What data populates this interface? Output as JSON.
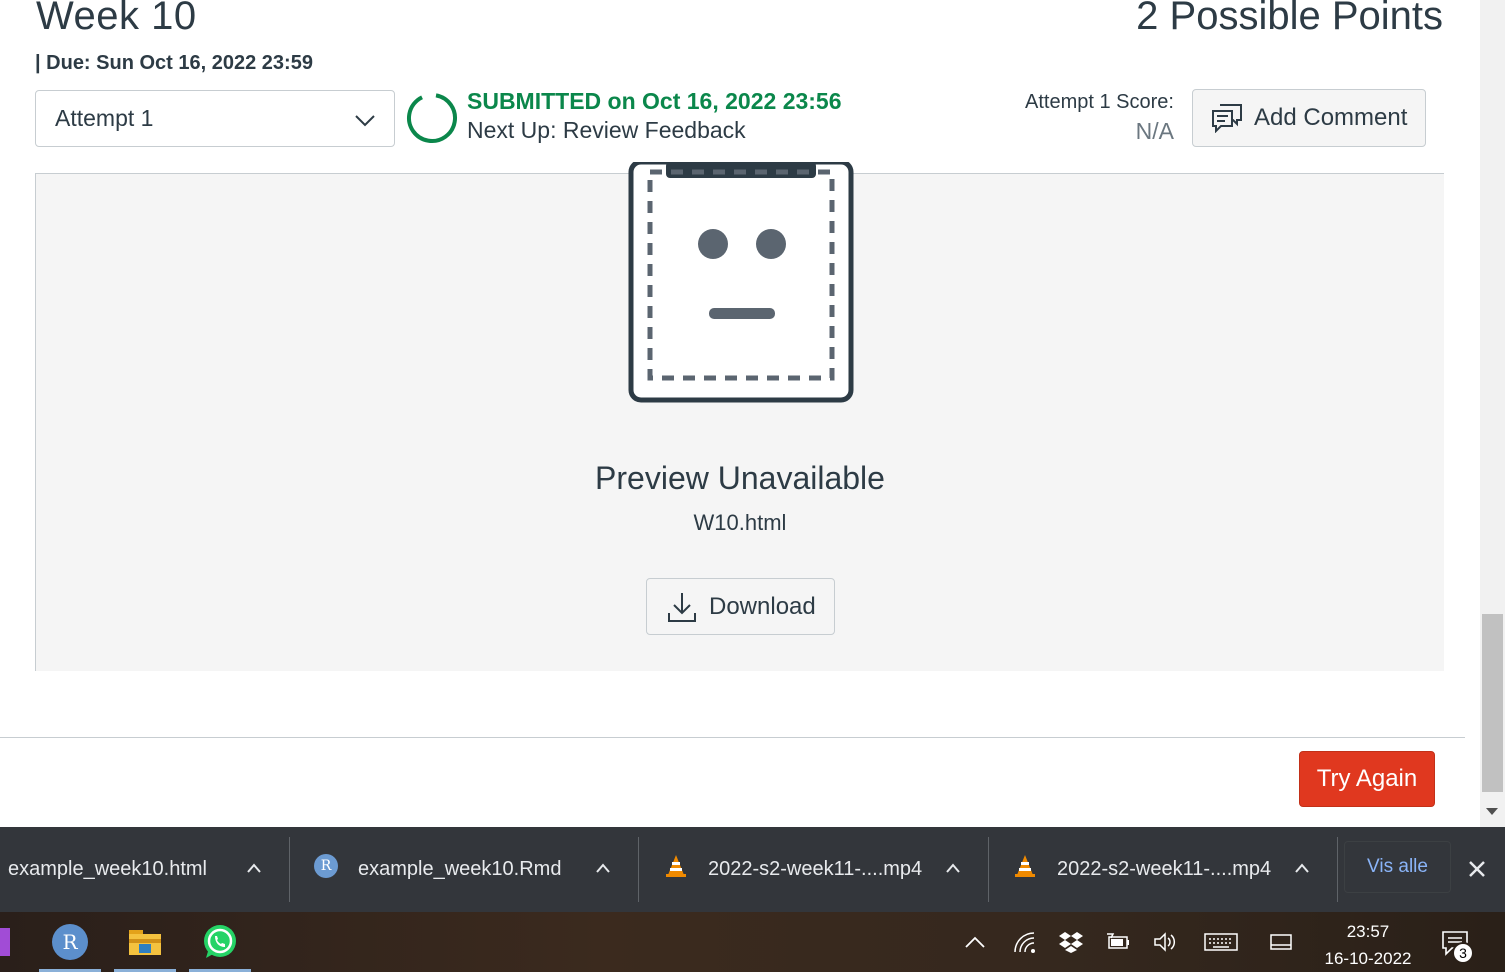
{
  "assignment": {
    "title": "Week 10",
    "points": "2 Possible Points",
    "due": "| Due: Sun Oct 16, 2022 23:59"
  },
  "attempt": {
    "selected": "Attempt 1",
    "status": "SUBMITTED on Oct 16, 2022 23:56",
    "next_up": "Next Up: Review Feedback",
    "score_label": "Attempt 1 Score:",
    "score_value": "N/A"
  },
  "add_comment_label": "Add Comment",
  "preview": {
    "title": "Preview Unavailable",
    "filename": "W10.html",
    "download_label": "Download"
  },
  "try_again_label": "Try Again",
  "downloads": {
    "items": [
      {
        "name": "example_week10.html",
        "icon": "html-file-icon"
      },
      {
        "name": "example_week10.Rmd",
        "icon": "r-file-icon"
      },
      {
        "name": "2022-s2-week11-....mp4",
        "icon": "vlc-icon"
      },
      {
        "name": "2022-s2-week11-....mp4",
        "icon": "vlc-icon"
      }
    ],
    "show_all_label": "Vis alle"
  },
  "taskbar": {
    "apps": [
      "r-app-icon",
      "file-explorer-icon",
      "whatsapp-icon"
    ],
    "time": "23:57",
    "date": "16-10-2022",
    "notification_count": "3"
  },
  "colors": {
    "submitted_green": "#0b874b",
    "try_again_red": "#e0381f",
    "text": "#2d3b45",
    "downloads_bg": "#33363b"
  }
}
